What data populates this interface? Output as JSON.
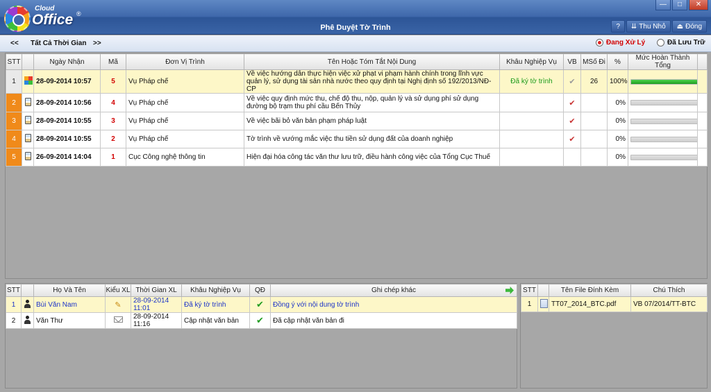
{
  "app": {
    "logo_small": "Cloud",
    "logo_big": "Office",
    "logo_reg": "®",
    "title": "Phê Duyệt Tờ Trình",
    "window_buttons": [
      "—",
      "□",
      "✕"
    ],
    "buttons": {
      "help_icon": "?",
      "minimize_label": "Thu Nhỏ",
      "close_label": "Đóng"
    }
  },
  "filter": {
    "prev": "<<",
    "range_label": "Tất Cả Thời Gian",
    "next": ">>",
    "radio_processing": "Đang Xử Lý",
    "radio_archived": "Đã Lưu Trữ",
    "selected": "processing"
  },
  "main_table": {
    "columns": [
      "STT",
      "Ngày Nhận",
      "Mã",
      "Đơn Vị Trình",
      "Tên Hoặc Tóm Tắt Nội Dung",
      "Khâu Nghiệp Vụ",
      "VB",
      "MSố Đi",
      "%",
      "Mức Hoàn Thành Tổng"
    ],
    "rows": [
      {
        "stt": "1",
        "date": "28-09-2014 10:57",
        "code": "5",
        "unit": "Vụ Pháp chế",
        "content": "Về việc hướng dẫn thực hiện việc xử phạt vi phạm hành chính trong lĩnh vực quản lý, sử dụng tài sản nhà nước theo quy định tại Nghị định số 192/2013/NĐ-CP",
        "stage": "Đã ký tờ trình",
        "vb": "✔",
        "msodi": "26",
        "pct": "100%",
        "progress": 1.0,
        "selected": true
      },
      {
        "stt": "2",
        "date": "28-09-2014 10:56",
        "code": "4",
        "unit": "Vụ Pháp chế",
        "content": "Về việc quy định mức thu, chế độ thu, nộp, quản lý và sử dụng phí sử dụng đường bộ trạm thu phí cầu Bến Thủy",
        "stage": "",
        "vb": "✔",
        "msodi": "",
        "pct": "0%",
        "progress": 0,
        "selected": false
      },
      {
        "stt": "3",
        "date": "28-09-2014 10:55",
        "code": "3",
        "unit": "Vụ Pháp chế",
        "content": "Về việc bãi bỏ văn bản phạm pháp luật",
        "stage": "",
        "vb": "✔",
        "msodi": "",
        "pct": "0%",
        "progress": 0,
        "selected": false
      },
      {
        "stt": "4",
        "date": "28-09-2014 10:55",
        "code": "2",
        "unit": "Vụ Pháp chế",
        "content": "Tờ trình về vướng mắc việc thu tiền sử dụng đất của doanh nghiệp",
        "stage": "",
        "vb": "✔",
        "msodi": "",
        "pct": "0%",
        "progress": 0,
        "selected": false
      },
      {
        "stt": "5",
        "date": "26-09-2014 14:04",
        "code": "1",
        "unit": "Cục Công nghệ thông tin",
        "content": "Hiện đại hóa công tác văn thư lưu trữ, điều hành công việc của Tổng Cục Thuế",
        "stage": "",
        "vb": "",
        "msodi": "",
        "pct": "0%",
        "progress": 0,
        "selected": false
      }
    ]
  },
  "process_table": {
    "columns": [
      "STT",
      "Họ Và Tên",
      "Kiểu XL",
      "Thời Gian XL",
      "Khâu Nghiệp Vụ",
      "QĐ",
      "Ghi chép khác"
    ],
    "rows": [
      {
        "stt": "1",
        "name": "Bùi Văn Nam",
        "type_icon": "pencil",
        "time": "28-09-2014 11:01",
        "stage": "Đã ký tờ trình",
        "qd": "✔",
        "note": "Đồng ý với nội dung tờ trình",
        "selected": true
      },
      {
        "stt": "2",
        "name": "Văn Thư",
        "type_icon": "envelope",
        "time": "28-09-2014 11:16",
        "stage": "Cập nhật văn bản",
        "qd": "✔",
        "note": "Đã cập nhật văn bản đi",
        "selected": false
      }
    ]
  },
  "attach_table": {
    "columns": [
      "STT",
      "Tên File Đính Kèm",
      "Chú Thích"
    ],
    "rows": [
      {
        "stt": "1",
        "file": "TT07_2014_BTC.pdf",
        "note": "VB 07/2014/TT-BTC",
        "selected": true
      }
    ]
  },
  "colors": {
    "accent": "#3f68ab",
    "row_highlight": "#fdf7c8",
    "stt_orange": "#f08a1a",
    "red": "#d20000",
    "green": "#1f9d1f"
  }
}
